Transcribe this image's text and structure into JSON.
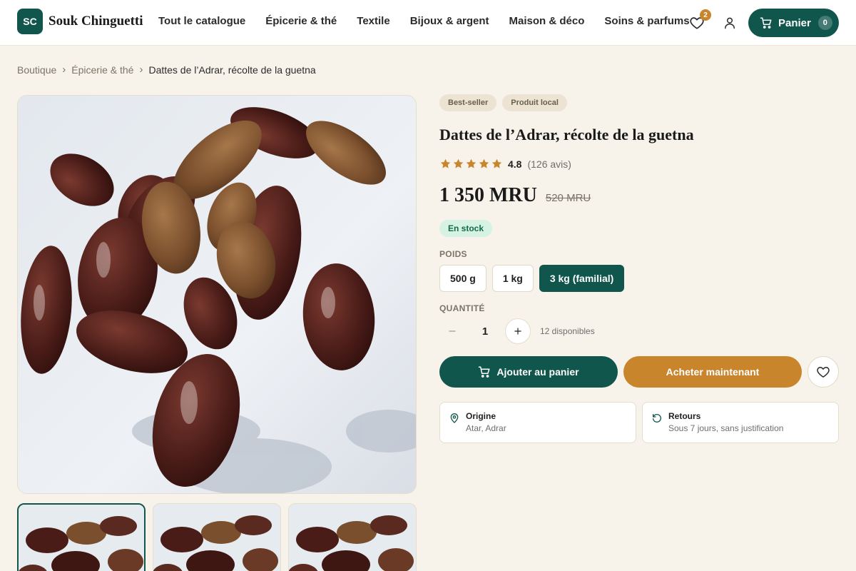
{
  "brand": {
    "initials": "SC",
    "name": "Souk Chinguetti"
  },
  "nav": {
    "items": [
      {
        "label": "Tout le catalogue"
      },
      {
        "label": "Épicerie & thé"
      },
      {
        "label": "Textile"
      },
      {
        "label": "Bijoux & argent"
      },
      {
        "label": "Maison & déco"
      },
      {
        "label": "Soins & parfums"
      }
    ]
  },
  "header": {
    "wishlist_count": "2",
    "cart_label": "Panier",
    "cart_count": "0"
  },
  "breadcrumb": {
    "items": [
      "Boutique",
      "Épicerie & thé"
    ],
    "current": "Dattes de l’Adrar, récolte de la guetna"
  },
  "product": {
    "tags": [
      "Best-seller",
      "Produit local"
    ],
    "title": "Dattes de l’Adrar, récolte de la guetna",
    "rating": {
      "stars": 5,
      "value": "4.8",
      "count": "(126 avis)"
    },
    "price": "1 350 MRU",
    "old_price": "520 MRU",
    "stock": "En stock",
    "weight_label": "POIDS",
    "weights": [
      "500 g",
      "1 kg",
      "3 kg (familial)"
    ],
    "selected_weight": "3 kg (familial)",
    "quantity_label": "QUANTITÉ",
    "quantity": "1",
    "available": "12 disponibles",
    "add_to_cart": "Ajouter au panier",
    "buy_now": "Acheter maintenant",
    "info": {
      "origin_title": "Origine",
      "origin_value": "Atar, Adrar",
      "returns_title": "Retours",
      "returns_value": "Sous 7 jours, sans justification"
    }
  },
  "colors": {
    "primary": "#10564d",
    "accent": "#c9852c",
    "background": "#f8f3ea",
    "star": "#c9852c"
  },
  "icons": [
    "heart-icon",
    "user-icon",
    "cart-icon",
    "chevron-right-icon",
    "star-icon",
    "minus-icon",
    "plus-icon",
    "location-pin-icon",
    "return-icon"
  ]
}
